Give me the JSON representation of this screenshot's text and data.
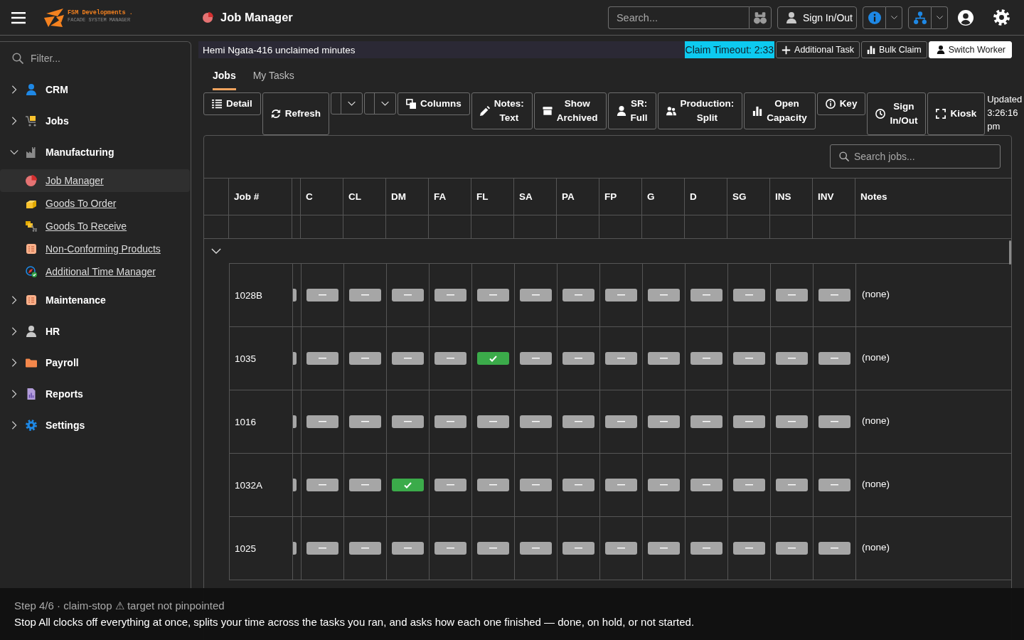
{
  "header": {
    "brand": {
      "name": "FSM Developments .",
      "tagline": "FACADE SYSTEM MANAGER"
    },
    "page_title": "Job Manager",
    "search": {
      "placeholder": "Search..."
    },
    "sign_in_out": "Sign In/Out"
  },
  "sidebar": {
    "filter": {
      "placeholder": "Filter..."
    },
    "items": [
      {
        "label": "CRM",
        "expanded": false
      },
      {
        "label": "Jobs",
        "expanded": false
      },
      {
        "label": "Manufacturing",
        "expanded": true,
        "children": [
          {
            "label": "Job Manager",
            "selected": true
          },
          {
            "label": "Goods To Order",
            "selected": false
          },
          {
            "label": "Goods To Receive",
            "selected": false
          },
          {
            "label": "Non-Conforming Products",
            "selected": false
          },
          {
            "label": "Additional Time Manager",
            "selected": false
          }
        ]
      },
      {
        "label": "Maintenance",
        "expanded": false
      },
      {
        "label": "HR",
        "expanded": false
      },
      {
        "label": "Payroll",
        "expanded": false
      },
      {
        "label": "Reports",
        "expanded": false
      },
      {
        "label": "Settings",
        "expanded": false
      }
    ]
  },
  "claim_bar": {
    "message": "Hemi Ngata-416 unclaimed minutes",
    "timeout": "Claim Timeout: 2:33",
    "buttons": [
      {
        "label": "Additional Task",
        "kind": "outline"
      },
      {
        "label": "Bulk Claim",
        "kind": "outline"
      },
      {
        "label": "Switch Worker",
        "kind": "light"
      }
    ]
  },
  "tabs": [
    {
      "label": "Jobs",
      "selected": true
    },
    {
      "label": "My Tasks",
      "selected": false
    }
  ],
  "toolbar": {
    "items": [
      {
        "kind": "button",
        "label": "Detail"
      },
      {
        "kind": "button",
        "label": "Refresh"
      },
      {
        "kind": "dropdown"
      },
      {
        "kind": "dropdown"
      },
      {
        "kind": "button",
        "label": "Columns"
      },
      {
        "kind": "button",
        "label": "Notes: Text"
      },
      {
        "kind": "button",
        "label": "Show Archived"
      },
      {
        "kind": "button",
        "label": "SR: Full"
      },
      {
        "kind": "button",
        "label": "Production: Split"
      },
      {
        "kind": "button",
        "label": "Open Capacity"
      },
      {
        "kind": "button",
        "label": "Key"
      },
      {
        "kind": "button",
        "label": "Sign In/Out"
      },
      {
        "kind": "button",
        "label": "Kiosk"
      }
    ],
    "updated": "Updated 3:26:16 pm"
  },
  "table": {
    "search": {
      "placeholder": "Search jobs..."
    },
    "columns": [
      "Job #",
      "C",
      "CL",
      "DM",
      "FA",
      "FL",
      "SA",
      "PA",
      "FP",
      "G",
      "D",
      "SG",
      "INS",
      "INV",
      "Notes"
    ],
    "group": {
      "expanded": true
    },
    "rows": [
      {
        "job": "1028B",
        "stages": [
          {
            "done": false
          },
          {
            "done": false
          },
          {
            "done": false
          },
          {
            "done": false
          },
          {
            "done": false
          },
          {
            "done": false
          },
          {
            "done": false
          },
          {
            "done": false
          },
          {
            "done": false
          },
          {
            "done": false
          },
          {
            "done": false
          },
          {
            "done": false
          },
          {
            "done": false
          }
        ],
        "notes": "(none)"
      },
      {
        "job": "1035",
        "stages": [
          {
            "done": false
          },
          {
            "done": false
          },
          {
            "done": false
          },
          {
            "done": false
          },
          {
            "done": true
          },
          {
            "done": false
          },
          {
            "done": false
          },
          {
            "done": false
          },
          {
            "done": false
          },
          {
            "done": false
          },
          {
            "done": false
          },
          {
            "done": false
          },
          {
            "done": false
          }
        ],
        "notes": "(none)"
      },
      {
        "job": "1016",
        "stages": [
          {
            "done": false
          },
          {
            "done": false
          },
          {
            "done": false
          },
          {
            "done": false
          },
          {
            "done": false
          },
          {
            "done": false
          },
          {
            "done": false
          },
          {
            "done": false
          },
          {
            "done": false
          },
          {
            "done": false
          },
          {
            "done": false
          },
          {
            "done": false
          },
          {
            "done": false
          }
        ],
        "notes": "(none)"
      },
      {
        "job": "1032A",
        "stages": [
          {
            "done": false
          },
          {
            "done": false
          },
          {
            "done": true
          },
          {
            "done": false
          },
          {
            "done": false
          },
          {
            "done": false
          },
          {
            "done": false
          },
          {
            "done": false
          },
          {
            "done": false
          },
          {
            "done": false
          },
          {
            "done": false
          },
          {
            "done": false
          },
          {
            "done": false
          }
        ],
        "notes": "(none)"
      },
      {
        "job": "1025",
        "stages": [
          {
            "done": false
          },
          {
            "done": false
          },
          {
            "done": false
          },
          {
            "done": false
          },
          {
            "done": false
          },
          {
            "done": false
          },
          {
            "done": false
          },
          {
            "done": false
          },
          {
            "done": false
          },
          {
            "done": false
          },
          {
            "done": false
          },
          {
            "done": false
          },
          {
            "done": false
          }
        ],
        "notes": "(none)"
      }
    ]
  },
  "tour_tip": {
    "step": "Step 4/6 · claim-stop ⚠ target not pinpointed",
    "text": "Stop All clocks off everything at once, splits your time across the tasks you ran, and asks how each one finished — done, on hold, or not started."
  }
}
